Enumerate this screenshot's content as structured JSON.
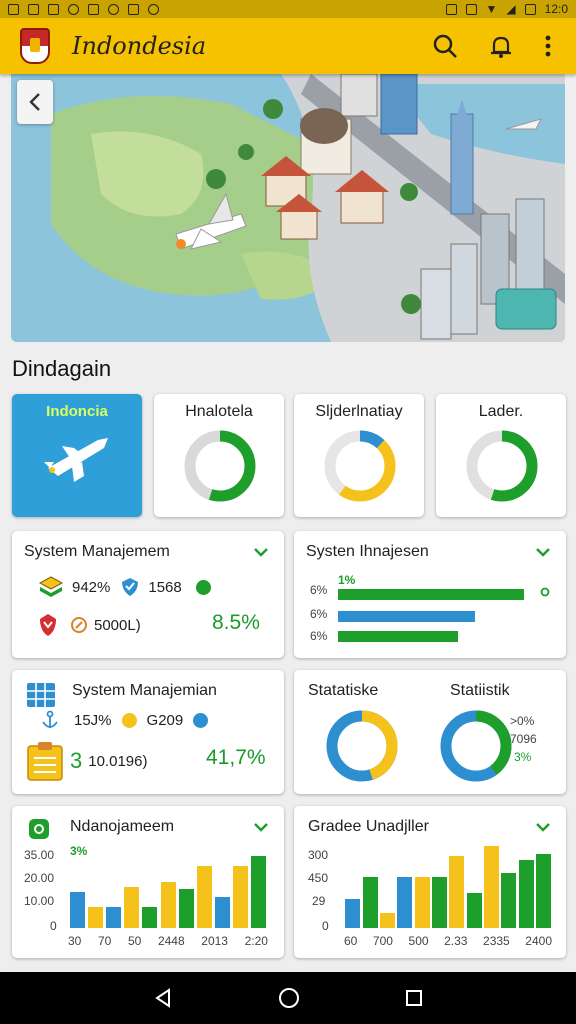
{
  "status_bar": {
    "time": "12:0"
  },
  "app_bar": {
    "title": "Indondesia",
    "icons": [
      "search-icon",
      "bell-icon",
      "more-vert-icon"
    ]
  },
  "hero": {
    "description_icons": [
      "back-arrow-icon"
    ]
  },
  "section": {
    "title": "Dindagain"
  },
  "tiles": [
    {
      "label": "Indoncia",
      "icon": "airplane-icon"
    },
    {
      "label": "Hnalotela",
      "donut": {
        "percent": 0.55,
        "color": "#1e9e2a",
        "base": "#d9d9d9"
      }
    },
    {
      "label": "Sljderlnatiay",
      "donut": {
        "percent": 0.6,
        "color": "#f5c21b",
        "secondary_percent": 0.12,
        "secondary_color": "#2e8fd0",
        "base": "#e6e6e6"
      }
    },
    {
      "label": "Lader.",
      "donut": {
        "percent": 0.55,
        "color": "#1e9e2a",
        "base": "#e0e0e0"
      }
    }
  ],
  "card1": {
    "title": "System Manajemem",
    "line1": {
      "a": "942%",
      "b": "1568"
    },
    "line2": {
      "a": "5000L)"
    },
    "big": "8.5%"
  },
  "card2": {
    "title": "Systen Ihnajesen",
    "bars": [
      {
        "label": "6%",
        "tag": "1%",
        "value": 0.96,
        "color": "#1e9e2a"
      },
      {
        "label": "6%",
        "value": 0.74,
        "color": "#2e8fd0"
      },
      {
        "label": "6%",
        "value": 0.6,
        "color": "#1e9e2a"
      }
    ],
    "colors": {
      "green": "#1e9e2a",
      "blue": "#2e8fd0"
    }
  },
  "card3": {
    "title": "System Manajemian",
    "line1": {
      "a": "15J%",
      "b": "G209"
    },
    "line2": {
      "a": "3",
      "b": "10.0196)"
    },
    "big": "41,7%"
  },
  "card4": {
    "title_left": "Statatiske",
    "title_right": "Statiistik",
    "donut_left": {
      "percent": 0.45,
      "color": "#f5c21b",
      "base": "#2e8fd0"
    },
    "donut_right": {
      "percent": 0.4,
      "color": "#1e9e2a",
      "base": "#2e8fd0"
    },
    "legend": [
      ">0%",
      "7096",
      "3%"
    ]
  },
  "card5": {
    "title": "Ndanojameem",
    "annotation": "3%",
    "y_ticks": [
      "35.00",
      "20.00",
      "10.00",
      "0"
    ],
    "x_ticks": [
      "30",
      "70",
      "50",
      "2448",
      "2013",
      "2:20"
    ]
  },
  "card6": {
    "title": "Gradee Unadjller",
    "y_ticks": [
      "300",
      "450",
      "29",
      "0"
    ],
    "x_ticks": [
      "60",
      "700",
      "500",
      "2.33",
      "2335",
      "2400"
    ]
  },
  "chart_data": [
    {
      "type": "bar",
      "title": "Ndanojameem",
      "categories": [
        "30",
        "70",
        "50",
        "2448",
        "2013",
        "2:20"
      ],
      "series": [
        {
          "values": [
            14,
            0,
            0,
            0,
            0,
            0
          ],
          "color": "#2e8fd0"
        },
        {
          "values": [
            0,
            8,
            16,
            18,
            24,
            24
          ],
          "color": "#f5c21b"
        },
        {
          "values": [
            0,
            8,
            8,
            15,
            12,
            28
          ],
          "color": "#mixed"
        }
      ],
      "bars": [
        {
          "h": 14,
          "c": "#2e8fd0"
        },
        {
          "h": 8,
          "c": "#f5c21b"
        },
        {
          "h": 8,
          "c": "#2e8fd0"
        },
        {
          "h": 16,
          "c": "#f5c21b"
        },
        {
          "h": 8,
          "c": "#1e9e2a"
        },
        {
          "h": 18,
          "c": "#f5c21b"
        },
        {
          "h": 15,
          "c": "#1e9e2a"
        },
        {
          "h": 24,
          "c": "#f5c21b"
        },
        {
          "h": 12,
          "c": "#2e8fd0"
        },
        {
          "h": 24,
          "c": "#f5c21b"
        },
        {
          "h": 28,
          "c": "#1e9e2a"
        }
      ],
      "ylim": [
        0,
        35
      ]
    },
    {
      "type": "bar",
      "title": "Gradee Unadjller",
      "categories": [
        "60",
        "700",
        "500",
        "2.33",
        "2335",
        "2400"
      ],
      "bars": [
        {
          "h": 28,
          "c": "#2e8fd0"
        },
        {
          "h": 50,
          "c": "#1e9e2a"
        },
        {
          "h": 15,
          "c": "#f5c21b"
        },
        {
          "h": 50,
          "c": "#2e8fd0"
        },
        {
          "h": 50,
          "c": "#f5c21b"
        },
        {
          "h": 50,
          "c": "#1e9e2a"
        },
        {
          "h": 70,
          "c": "#f5c21b"
        },
        {
          "h": 34,
          "c": "#1e9e2a"
        },
        {
          "h": 80,
          "c": "#f5c21b"
        },
        {
          "h": 54,
          "c": "#1e9e2a"
        },
        {
          "h": 66,
          "c": "#1e9e2a"
        },
        {
          "h": 72,
          "c": "#1e9e2a"
        }
      ],
      "ylim": [
        0,
        300
      ]
    }
  ]
}
